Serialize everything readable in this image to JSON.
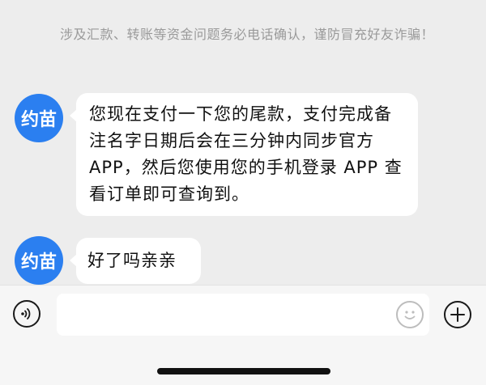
{
  "chat": {
    "notice": "涉及汇款、转账等资金问题务必电话确认，谨防冒充好友诈骗！",
    "messages": [
      {
        "sender_avatar": "约苗",
        "text": "您现在支付一下您的尾款，支付完成备注名字日期后会在三分钟内同步官方 APP，然后您使用您的手机登录 APP 查看订单即可查询到。"
      },
      {
        "sender_avatar": "约苗",
        "text": "好了吗亲亲"
      }
    ]
  },
  "input_bar": {
    "text_value": "",
    "icons": {
      "voice": "voice-icon",
      "emoji": "emoji-icon",
      "plus": "plus-icon"
    }
  },
  "colors": {
    "avatar_bg": "#2b7ff0",
    "chat_bg": "#ededed",
    "bubble_bg": "#ffffff",
    "notice_text": "#9a9a9a"
  }
}
